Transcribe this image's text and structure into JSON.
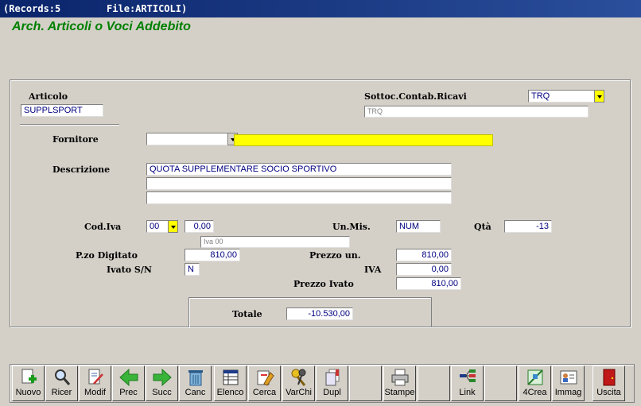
{
  "window": {
    "title": "(Records:5        File:ARTICOLI)"
  },
  "app_title": "Arch. Articoli o Voci Addebito",
  "form": {
    "articolo_label": "Articolo",
    "articolo_value": "SUPPLSPORT",
    "sottoconto_label": "Sottoc.Contab.Ricavi",
    "sottoconto_value": "TRQ",
    "sottoconto_desc": "TRQ",
    "fornitore_label": "Fornitore",
    "fornitore_code": "",
    "fornitore_name": "",
    "descrizione_label": "Descrizione",
    "descrizione_1": "QUOTA SUPPLEMENTARE SOCIO SPORTIVO",
    "descrizione_2": "",
    "descrizione_3": "",
    "codiva_label": "Cod.Iva",
    "codiva_value": "00",
    "codiva_perc": "0,00",
    "codiva_desc": "Iva 00",
    "unmis_label": "Un.Mis.",
    "unmis_value": "NUM",
    "qta_label": "Qtà",
    "qta_value": "-13",
    "pzo_label": "P.zo Digitato",
    "pzo_value": "810,00",
    "ivato_label": "Ivato S/N",
    "ivato_value": "N",
    "prezzo_un_label": "Prezzo un.",
    "prezzo_un_value": "810,00",
    "iva_label": "IVA",
    "iva_value": "0,00",
    "prezzo_ivato_label": "Prezzo Ivato",
    "prezzo_ivato_value": "810,00",
    "totale_label": "Totale",
    "totale_value": "-10.530,00"
  },
  "toolbar": [
    {
      "label": "Nuovo",
      "icon": "new-doc-icon"
    },
    {
      "label": "Ricer",
      "icon": "magnifier-icon"
    },
    {
      "label": "Modif",
      "icon": "edit-doc-icon"
    },
    {
      "label": "Prec",
      "icon": "arrow-left-icon"
    },
    {
      "label": "Succ",
      "icon": "arrow-right-icon"
    },
    {
      "label": "Canc",
      "icon": "trash-icon"
    },
    {
      "label": "Elenco",
      "icon": "list-icon"
    },
    {
      "label": "Cerca",
      "icon": "search-doc-icon"
    },
    {
      "label": "VarChi",
      "icon": "keys-icon"
    },
    {
      "label": "Dupl",
      "icon": "duplicate-icon"
    },
    {
      "label": "",
      "icon": ""
    },
    {
      "label": "Stampe",
      "icon": "printer-icon"
    },
    {
      "label": "",
      "icon": ""
    },
    {
      "label": "Link",
      "icon": "link-icon"
    },
    {
      "label": "",
      "icon": ""
    },
    {
      "label": "4Crea",
      "icon": "create-icon"
    },
    {
      "label": "Immag",
      "icon": "image-card-icon"
    },
    {
      "label": "Uscita",
      "icon": "exit-door-icon"
    }
  ],
  "colors": {
    "accent_green": "#008000",
    "yellow": "#ffff00",
    "text_blue": "#000080"
  }
}
